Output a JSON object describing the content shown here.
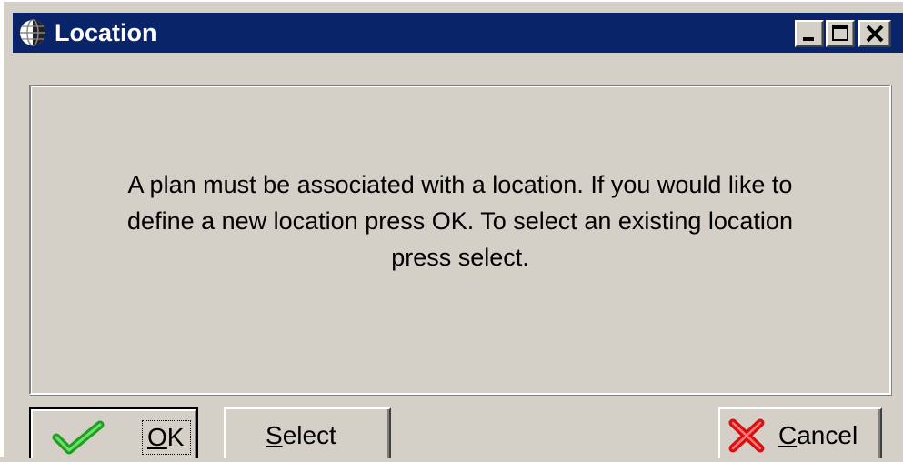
{
  "window": {
    "title": "Location",
    "icon": "globe-icon",
    "controls": [
      "minimize-icon",
      "maximize-icon",
      "close-icon"
    ]
  },
  "message": {
    "line1": "A plan must be associated with a location.  If you would like to",
    "line2": "define a new location press OK.  To select an existing location",
    "line3": "press select."
  },
  "buttons": {
    "ok": {
      "mnemonic": "O",
      "rest": "K",
      "icon": "checkmark-icon",
      "icon_color": "#1f9e1f"
    },
    "select": {
      "mnemonic": "S",
      "rest": "elect"
    },
    "cancel": {
      "mnemonic": "C",
      "rest": "ancel",
      "icon": "x-icon",
      "icon_color": "#d81010"
    }
  },
  "colors": {
    "titlebar": "#0a246a",
    "face": "#d4d0c8"
  }
}
